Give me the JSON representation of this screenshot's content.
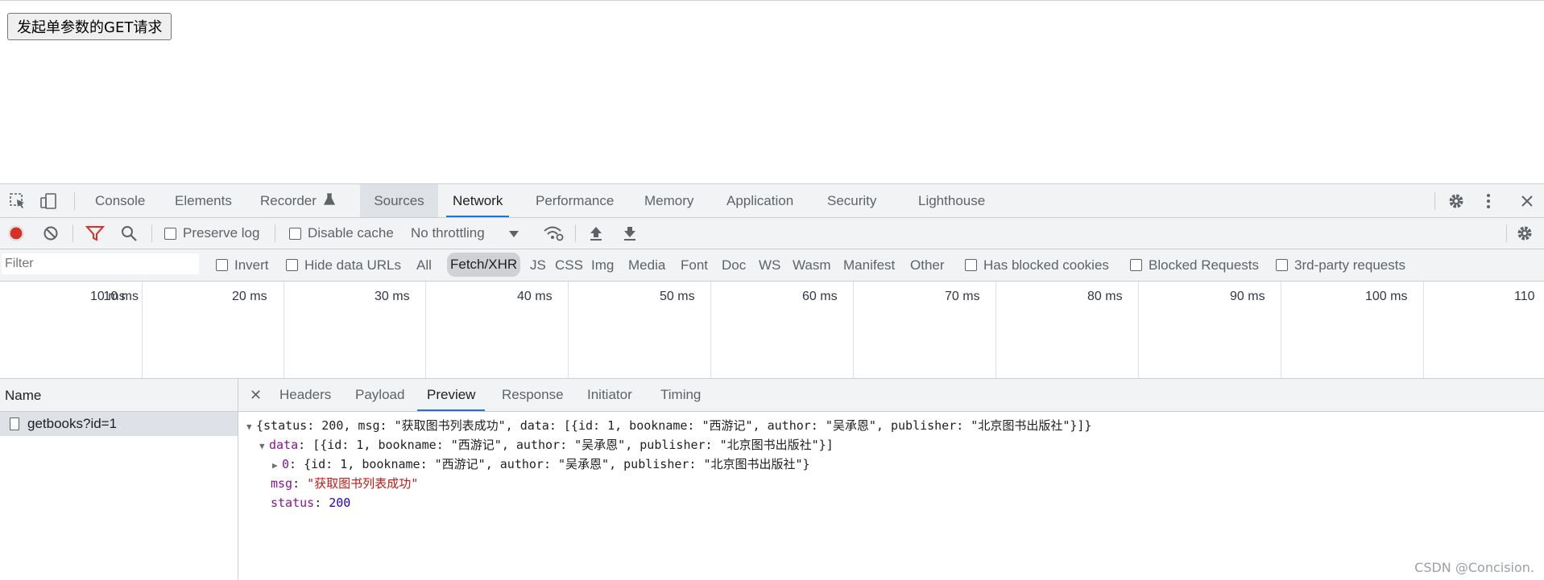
{
  "page": {
    "button_label": "发起单参数的GET请求"
  },
  "devtools": {
    "tabs": [
      "Console",
      "Elements",
      "Recorder",
      "Sources",
      "Network",
      "Performance",
      "Memory",
      "Application",
      "Security",
      "Lighthouse"
    ],
    "active_tab": "Network",
    "toolbar": {
      "preserve_log": "Preserve log",
      "disable_cache": "Disable cache",
      "throttling": "No throttling"
    },
    "filter": {
      "placeholder": "Filter",
      "invert": "Invert",
      "hide_data_urls": "Hide data URLs",
      "types": [
        "All",
        "Fetch/XHR",
        "JS",
        "CSS",
        "Img",
        "Media",
        "Font",
        "Doc",
        "WS",
        "Wasm",
        "Manifest",
        "Other"
      ],
      "selected_type": "Fetch/XHR",
      "has_blocked_cookies": "Has blocked cookies",
      "blocked_requests": "Blocked Requests",
      "third_party": "3rd-party requests"
    },
    "timeline_ticks": [
      "10 ms",
      "20 ms",
      "30 ms",
      "40 ms",
      "50 ms",
      "60 ms",
      "70 ms",
      "80 ms",
      "90 ms",
      "100 ms",
      "110"
    ],
    "requests": {
      "header": "Name",
      "items": [
        "getbooks?id=1"
      ]
    },
    "detail_tabs": [
      "Headers",
      "Payload",
      "Preview",
      "Response",
      "Initiator",
      "Timing"
    ],
    "active_detail_tab": "Preview",
    "preview": {
      "root_line": "{status: 200, msg: \"获取图书列表成功\", data: [{id: 1, bookname: \"西游记\", author: \"吴承恩\", publisher: \"北京图书出版社\"}]}",
      "data_key": "data",
      "data_summary": "[{id: 1, bookname: \"西游记\", author: \"吴承恩\", publisher: \"北京图书出版社\"}]",
      "item_key": "0",
      "item_summary": "{id: 1, bookname: \"西游记\", author: \"吴承恩\", publisher: \"北京图书出版社\"}",
      "msg_key": "msg",
      "msg_value": "\"获取图书列表成功\"",
      "status_key": "status",
      "status_value": "200"
    }
  },
  "watermark": "CSDN @Concision."
}
